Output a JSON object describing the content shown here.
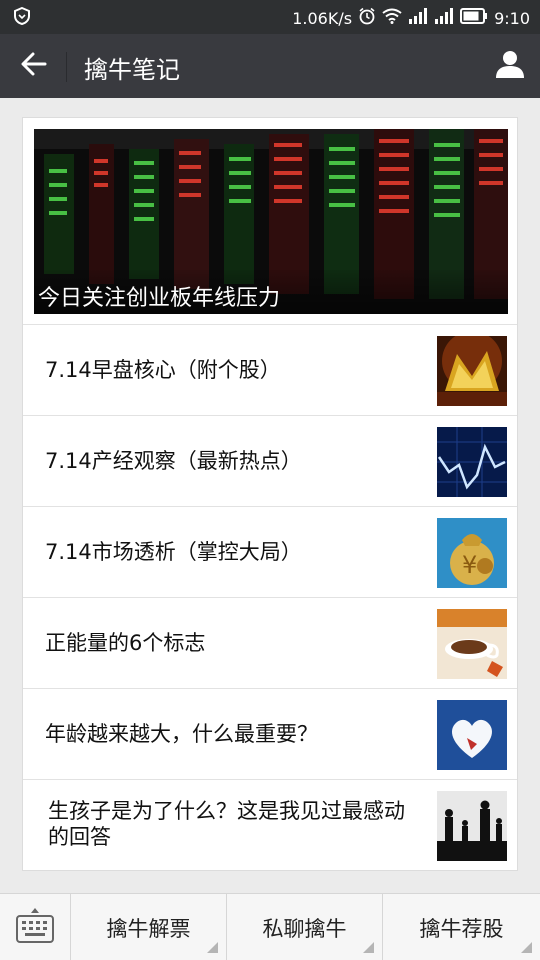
{
  "status": {
    "net_speed": "1.06K/s",
    "time": "9:10",
    "icons": [
      "shield-icon",
      "alarm-icon",
      "wifi-icon",
      "signal-icon",
      "signal-icon",
      "battery-icon"
    ]
  },
  "titlebar": {
    "title": "擒牛笔记",
    "back_icon": "arrow-left-icon",
    "profile_icon": "person-icon"
  },
  "top_story": {
    "caption": "今日关注创业板年线压力"
  },
  "articles": [
    {
      "title": "7.14早盘核心（附个股）",
      "thumb": "golden-letters-thumb"
    },
    {
      "title": "7.14产经观察（最新热点）",
      "thumb": "stock-chart-thumb"
    },
    {
      "title": "7.14市场透析（掌控大局）",
      "thumb": "money-bag-thumb"
    },
    {
      "title": "正能量的6个标志",
      "thumb": "coffee-cup-thumb"
    },
    {
      "title": "年龄越来越大，什么最重要？",
      "thumb": "heart-sky-thumb"
    },
    {
      "title": "生孩子是为了什么？这是我见过最感动的回答",
      "thumb": "family-silhouette-thumb"
    }
  ],
  "bottom_menu": {
    "keyboard_icon": "keyboard-icon",
    "items": [
      "擒牛解票",
      "私聊擒牛",
      "擒牛荐股"
    ]
  }
}
